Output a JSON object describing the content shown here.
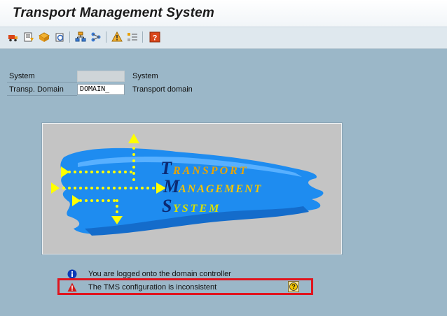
{
  "window": {
    "title": "Transport Management System"
  },
  "toolbar": {
    "buttons": [
      {
        "icon": "transport-routes-icon"
      },
      {
        "icon": "import-overview-icon"
      },
      {
        "icon": "transport-requests-icon"
      },
      {
        "icon": "refresh-icon"
      },
      {
        "icon": "system-overview-icon"
      },
      {
        "icon": "transport-network-icon"
      },
      {
        "icon": "alerts-icon"
      },
      {
        "icon": "qa-worklist-icon"
      },
      {
        "icon": "help-icon"
      }
    ]
  },
  "form": {
    "system": {
      "label": "System",
      "value": "",
      "description": "System"
    },
    "domain": {
      "label": "Transp. Domain",
      "value": "DOMAIN_",
      "description": "Transport domain"
    }
  },
  "logo": {
    "line1": "RANSPORT",
    "line2": "ANAGEMENT",
    "line3": "YSTEM",
    "initial1": "T",
    "initial2": "M",
    "initial3": "S"
  },
  "messages": [
    {
      "type": "info",
      "icon": "info-icon",
      "text": "You are logged onto the domain controller"
    },
    {
      "type": "warning",
      "icon": "warning-icon",
      "text": "The TMS configuration is inconsistent"
    }
  ],
  "colors": {
    "highlight": "#e0141e",
    "logo_blue": "#1e8cf0",
    "arrow_yellow": "#ffff00"
  }
}
